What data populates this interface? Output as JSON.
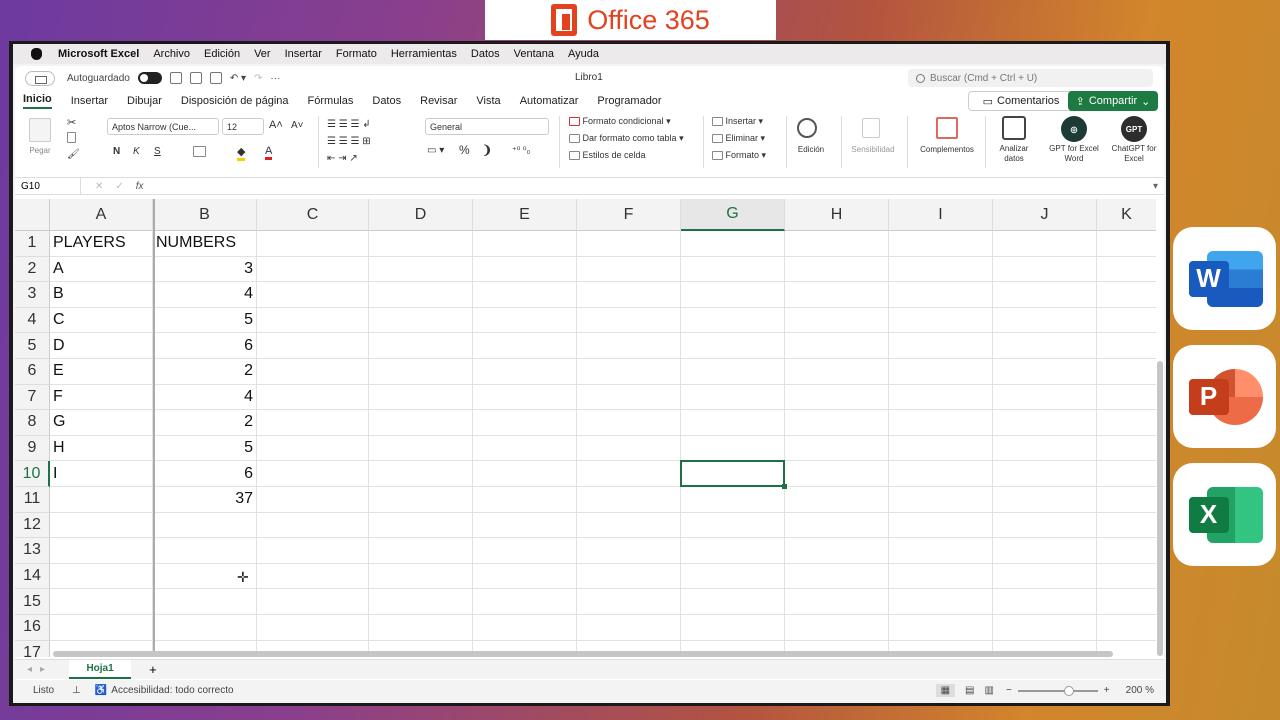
{
  "banner": {
    "text": "Office 365"
  },
  "menubar": {
    "items": [
      "Microsoft Excel",
      "Archivo",
      "Edición",
      "Ver",
      "Insertar",
      "Formato",
      "Herramientas",
      "Datos",
      "Ventana",
      "Ayuda"
    ]
  },
  "titlebar": {
    "autosave": "Autoguardado",
    "title": "Libro1",
    "search_placeholder": "Buscar (Cmd + Ctrl + U)"
  },
  "tabs": [
    "Inicio",
    "Insertar",
    "Dibujar",
    "Disposición de página",
    "Fórmulas",
    "Datos",
    "Revisar",
    "Vista",
    "Automatizar",
    "Programador"
  ],
  "buttons": {
    "comments": "Comentarios",
    "share": "Compartir"
  },
  "ribbon": {
    "paste": "Pegar",
    "font": "Aptos Narrow (Cue...",
    "size": "12",
    "number_format": "General",
    "bold": "N",
    "italic": "K",
    "strike": "S",
    "percent": "%",
    "comma": "❩",
    "cond_format": "Formato condicional",
    "table_format": "Dar formato como tabla",
    "cell_styles": "Estilos de celda",
    "insert": "Insertar",
    "delete": "Eliminar",
    "format": "Formato",
    "edit": "Edición",
    "sensitivity": "Sensibilidad",
    "addins": "Complementos",
    "analyze": "Analizar datos",
    "gpt_word": "GPT for Excel Word",
    "chatgpt": "ChatGPT for Excel",
    "gpt_badge": "GPT"
  },
  "formula": {
    "namebox": "G10",
    "fx": "fx",
    "value": ""
  },
  "columns": [
    "A",
    "B",
    "C",
    "D",
    "E",
    "F",
    "G",
    "H",
    "I",
    "J",
    "K"
  ],
  "rows": [
    "1",
    "2",
    "3",
    "4",
    "5",
    "6",
    "7",
    "8",
    "9",
    "10",
    "11",
    "12",
    "13",
    "14",
    "15",
    "16",
    "17"
  ],
  "cells": {
    "r1": {
      "a": "PLAYERS",
      "b": "NUMBERS"
    },
    "r2": {
      "a": "A",
      "b": "3"
    },
    "r3": {
      "a": "B",
      "b": "4"
    },
    "r4": {
      "a": "C",
      "b": "5"
    },
    "r5": {
      "a": "D",
      "b": "6"
    },
    "r6": {
      "a": "E",
      "b": "2"
    },
    "r7": {
      "a": "F",
      "b": "4"
    },
    "r8": {
      "a": "G",
      "b": "2"
    },
    "r9": {
      "a": "H",
      "b": "5"
    },
    "r10": {
      "a": "I",
      "b": "6"
    },
    "r11": {
      "a": "",
      "b": "37"
    }
  },
  "selected_cell": "G10",
  "sheets": [
    "Hoja1"
  ],
  "status": {
    "ready": "Listo",
    "accessibility": "Accesibilidad: todo correcto",
    "zoom": "200 %"
  },
  "apps": {
    "word": "W",
    "powerpoint": "P",
    "excel": "X"
  },
  "colors": {
    "accent": "#1e7145",
    "share": "#1e7a43",
    "office": "#e3421f"
  }
}
